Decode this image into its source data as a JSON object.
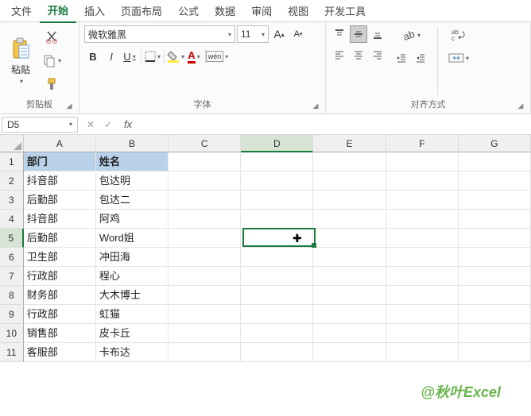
{
  "tabs": [
    "文件",
    "开始",
    "插入",
    "页面布局",
    "公式",
    "数据",
    "审阅",
    "视图",
    "开发工具"
  ],
  "active_tab": 1,
  "ribbon": {
    "clipboard": {
      "paste": "粘贴",
      "label": "剪贴板"
    },
    "font": {
      "name": "微软雅黑",
      "size": "11",
      "label": "字体"
    },
    "alignment": {
      "label": "对齐方式"
    }
  },
  "namebox": "D5",
  "active": {
    "row": 5,
    "col": "D"
  },
  "columns": [
    "A",
    "B",
    "C",
    "D",
    "E",
    "F",
    "G"
  ],
  "headers": [
    "部门",
    "姓名"
  ],
  "rows": [
    {
      "n": 1,
      "a": "部门",
      "b": "姓名",
      "hdr": true
    },
    {
      "n": 2,
      "a": "抖音部",
      "b": "包达明"
    },
    {
      "n": 3,
      "a": "后勤部",
      "b": "包达二"
    },
    {
      "n": 4,
      "a": "抖音部",
      "b": "阿鸡"
    },
    {
      "n": 5,
      "a": "后勤部",
      "b": "Word姐"
    },
    {
      "n": 6,
      "a": "卫生部",
      "b": "冲田海"
    },
    {
      "n": 7,
      "a": "行政部",
      "b": "程心"
    },
    {
      "n": 8,
      "a": "财务部",
      "b": "大木博士"
    },
    {
      "n": 9,
      "a": "行政部",
      "b": "虹猫"
    },
    {
      "n": 10,
      "a": "销售部",
      "b": "皮卡丘"
    },
    {
      "n": 11,
      "a": "客服部",
      "b": "卡布达"
    }
  ],
  "watermark": "@秋叶Excel"
}
